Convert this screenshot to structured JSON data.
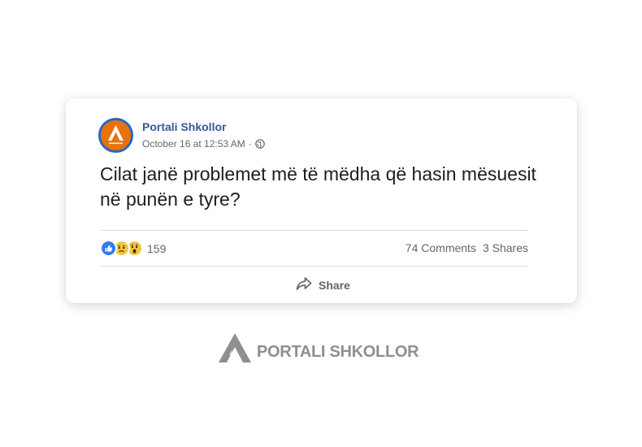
{
  "post": {
    "page_name": "Portali Shkollor",
    "timestamp": "October 16 at 12:53 AM",
    "separator": "·",
    "privacy_icon": "globe-icon",
    "text": "Cilat janë problemet më të mëdha që hasin mësuesit në punën e tyre?",
    "reactions": {
      "icons": [
        "like-icon",
        "sad-icon",
        "wow-icon"
      ],
      "count": "159"
    },
    "comments": "74 Comments",
    "shares": "3 Shares",
    "share_label": "Share",
    "share_icon": "share-arrow-icon"
  },
  "footer": {
    "logo_text": "PORTALI SHKOLLOR"
  },
  "colors": {
    "page_name": "#385898",
    "avatar_bg": "#e8720c",
    "avatar_ring": "#2a66c5",
    "text": "#1c1e21",
    "muted": "#606770",
    "footer_logo": "#8f8f8f"
  }
}
